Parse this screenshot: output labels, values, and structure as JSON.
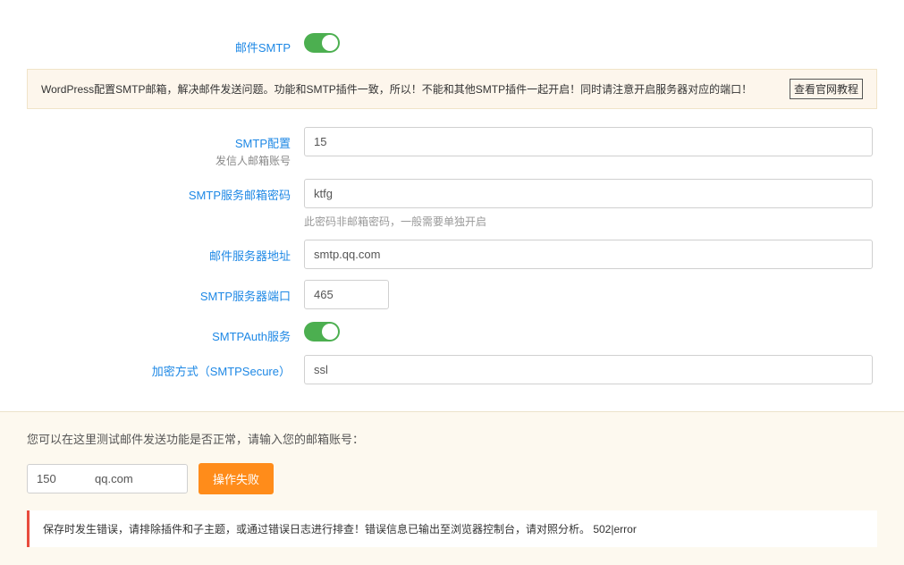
{
  "smtp_toggle": {
    "label": "邮件SMTP",
    "state": "on"
  },
  "notice": {
    "text": "WordPress配置SMTP邮箱，解决邮件发送问题。功能和SMTP插件一致，所以！不能和其他SMTP插件一起开启！同时请注意开启服务器对应的端口！",
    "link_label": "查看官网教程"
  },
  "fields": {
    "smtp_config": {
      "label": "SMTP配置",
      "sublabel": "发信人邮箱账号",
      "value": "15"
    },
    "smtp_password": {
      "label": "SMTP服务邮箱密码",
      "value": "ktfg",
      "help": "此密码非邮箱密码，一般需要单独开启"
    },
    "mail_server": {
      "label": "邮件服务器地址",
      "value": "smtp.qq.com"
    },
    "smtp_port": {
      "label": "SMTP服务器端口",
      "value": "465"
    },
    "smtp_auth": {
      "label": "SMTPAuth服务",
      "state": "on"
    },
    "smtp_secure": {
      "label": "加密方式（SMTPSecure）",
      "value": "ssl"
    }
  },
  "test": {
    "prompt": "您可以在这里测试邮件发送功能是否正常，请输入您的邮箱账号：",
    "input_value": "150            qq.com",
    "button_label": "操作失败"
  },
  "error": {
    "text": "保存时发生错误，请排除插件和子主题，或通过错误日志进行排查！错误信息已输出至浏览器控制台，请对照分析。 502|error"
  }
}
